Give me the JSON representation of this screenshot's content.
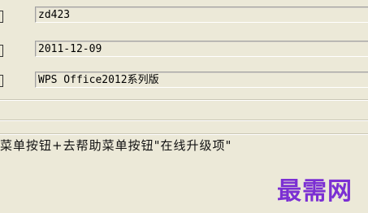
{
  "fields": [
    {
      "value": "zd423"
    },
    {
      "value": "2011-12-09"
    },
    {
      "value": "WPS Office2012系列版"
    }
  ],
  "instruction": "菜单按钮+去帮助菜单按钮\"在线升级项\"",
  "watermark": "最需网"
}
